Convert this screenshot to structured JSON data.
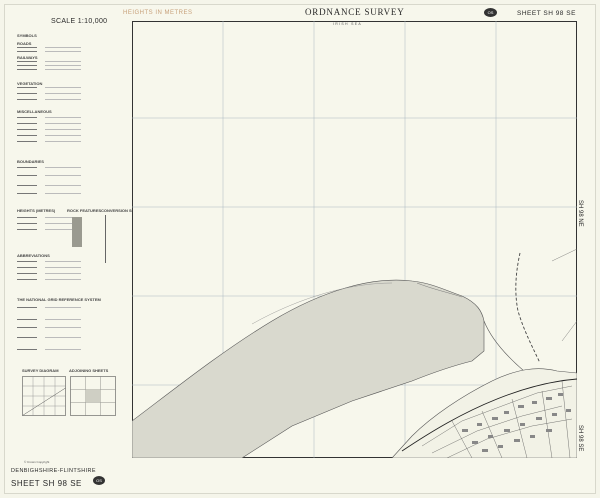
{
  "header": {
    "scale": "SCALE 1:10,000",
    "heights": "HEIGHTS IN METRES",
    "title": "ORDNANCE SURVEY",
    "sheet": "SHEET SH 98 SE",
    "logo_text": "OS"
  },
  "map": {
    "sea_label": "IRISH SEA",
    "colors": {
      "paper": "#f7f7ec",
      "sand": "#d9d9ce",
      "linework": "#444444",
      "grid": "#a9b7c0"
    }
  },
  "legend": {
    "sections": [
      "SYMBOLS",
      "ROADS",
      "RAILWAYS",
      "VEGETATION",
      "MISCELLANEOUS",
      "BOUNDARIES",
      "HEIGHTS (METRES)",
      "ROCK FEATURES",
      "CONVERSION SCALE",
      "ABBREVIATIONS",
      "THE NATIONAL GRID REFERENCE SYSTEM",
      "SURVEY DIAGRAM",
      "ADJOINING SHEETS"
    ]
  },
  "footer": {
    "county": "DENBIGHSHIRE-FLINTSHIRE",
    "sheet": "SHEET SH 98 SE",
    "logo_text": "OS",
    "copyright": "© Crown Copyright"
  },
  "side_labels": [
    "SH 98 NE",
    "SH 98 SE"
  ]
}
